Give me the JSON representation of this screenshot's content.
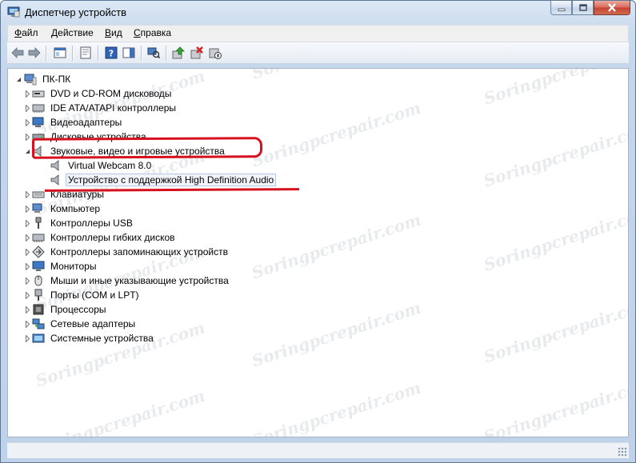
{
  "window": {
    "title": "Диспетчер устройств"
  },
  "menu": [
    {
      "pre": "",
      "ul": "Ф",
      "post": "айл"
    },
    {
      "pre": "",
      "ul": "Д",
      "post": "ействие"
    },
    {
      "pre": "",
      "ul": "В",
      "post": "ид"
    },
    {
      "pre": "",
      "ul": "С",
      "post": "правка"
    }
  ],
  "tree": {
    "root": "ПК-ПК",
    "items": [
      "DVD и CD-ROM дисководы",
      "IDE ATA/ATAPI контроллеры",
      "Видеоадаптеры",
      "Дисковые устройства",
      "Звуковые, видео и игровые устройства",
      "Virtual Webcam 8.0",
      "Устройство с поддержкой High Definition Audio",
      "Клавиатуры",
      "Компьютер",
      "Контроллеры USB",
      "Контроллеры гибких дисков",
      "Контроллеры запоминающих устройств",
      "Мониторы",
      "Мыши и иные указывающие устройства",
      "Порты (COM и LPT)",
      "Процессоры",
      "Сетевые адаптеры",
      "Системные устройства"
    ]
  },
  "watermark": "Soringpcrepair.com",
  "colors": {
    "highlight_marker": "#d6101c",
    "selection_bg": "#f1f5fb"
  }
}
